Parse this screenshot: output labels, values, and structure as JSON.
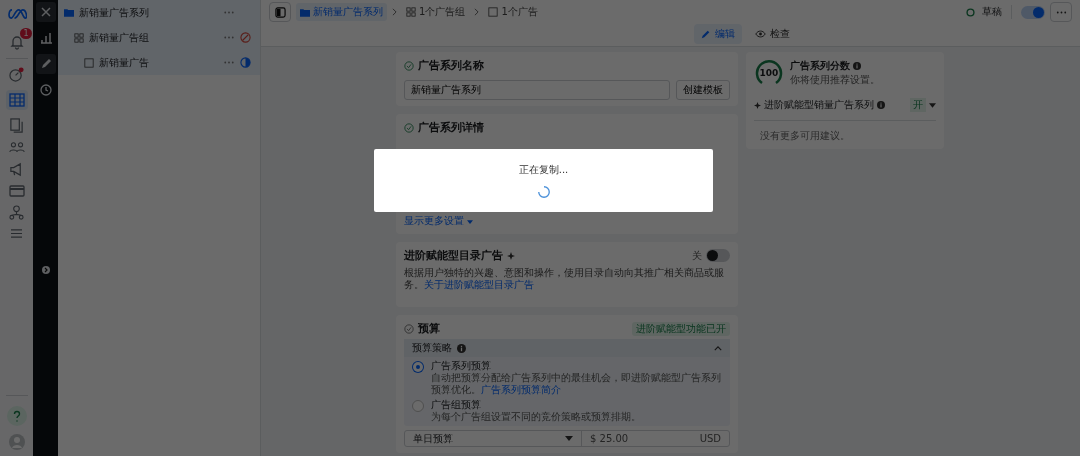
{
  "rail": {
    "notification_badge": "1"
  },
  "tree": [
    {
      "label": "新销量广告系列",
      "kind": "campaign",
      "children": [
        {
          "label": "新销量广告组",
          "kind": "adset",
          "children": [
            {
              "label": "新销量广告",
              "kind": "ad"
            }
          ]
        }
      ]
    }
  ],
  "breadcrumbs": [
    {
      "label": "新销量广告系列",
      "kind": "campaign",
      "selected": true
    },
    {
      "label": "1个广告组",
      "kind": "adset",
      "selected": false
    },
    {
      "label": "1个广告",
      "kind": "ad",
      "selected": false
    }
  ],
  "view_tabs": [
    {
      "label": "编辑",
      "kind": "edit",
      "selected": true
    },
    {
      "label": "检查",
      "kind": "review",
      "selected": false
    }
  ],
  "status": {
    "label": "草稿"
  },
  "publish_toggle": {
    "on": true
  },
  "name_card": {
    "title": "广告系列名称",
    "value": "新销量广告系列",
    "button": "创建模板"
  },
  "details_card": {
    "title": "广告系列详情",
    "link": "显示更多设置"
  },
  "catalog_card": {
    "title": "进阶赋能型目录广告",
    "toggle_label": "关",
    "on": false,
    "description": "根据用户独特的兴趣、意图和操作，使用目录自动向其推广相关商品或服务。",
    "link": "关于进阶赋能型目录广告"
  },
  "budget_card": {
    "title": "预算",
    "badge": "进阶赋能型功能已开",
    "strategy_label": "预算策略",
    "expanded": true,
    "options": [
      {
        "title": "广告系列预算",
        "description": "自动把预算分配给广告系列中的最佳机会，即进阶赋能型广告系列预算优化。",
        "link": "广告系列预算简介",
        "selected": true
      },
      {
        "title": "广告组预算",
        "description": "为每个广告组设置不同的竞价策略或预算排期。",
        "selected": false
      }
    ],
    "budget_type": "单日预算",
    "amount": "$ 25.00",
    "currency": "USD"
  },
  "score_card": {
    "score": "100",
    "title": "广告系列分数",
    "subtitle": "你将使用推荐设置。",
    "row_label": "进阶赋能型销量广告系列",
    "row_value": "开",
    "empty": "没有更多可用建议。"
  },
  "dialog": {
    "message": "正在复制..."
  }
}
